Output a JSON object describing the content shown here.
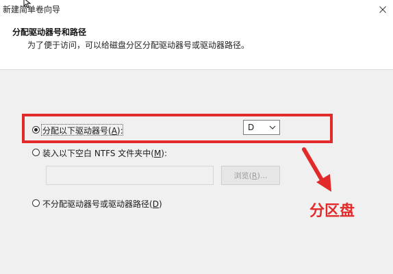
{
  "window": {
    "title": "新建简单卷向导"
  },
  "header": {
    "title": "分配驱动器号和路径",
    "subtitle": "为了便于访问，可以给磁盘分区分配驱动器号或驱动器路径。"
  },
  "options": {
    "assign_letter": {
      "label_pre": "分配以下驱动器号(",
      "hotkey": "A",
      "label_post": "):",
      "selected": true
    },
    "mount_folder": {
      "label_pre": "装入以下空白 NTFS 文件夹中(",
      "hotkey": "M",
      "label_post": "):",
      "selected": false
    },
    "no_assign": {
      "label_pre": "不分配驱动器号或驱动器路径(",
      "hotkey": "D",
      "label_post": ")",
      "selected": false
    }
  },
  "drive_select": {
    "value": "D"
  },
  "folder_path": {
    "value": ""
  },
  "browse_button": {
    "label_pre": "浏览(",
    "hotkey": "R",
    "label_post": ")..."
  },
  "annotation": {
    "text": "分区盘",
    "color": "#e32a2a"
  },
  "icons": [
    "close-icon",
    "mouse-cursor-icon",
    "chevron-down-icon",
    "red-arrow-icon"
  ]
}
